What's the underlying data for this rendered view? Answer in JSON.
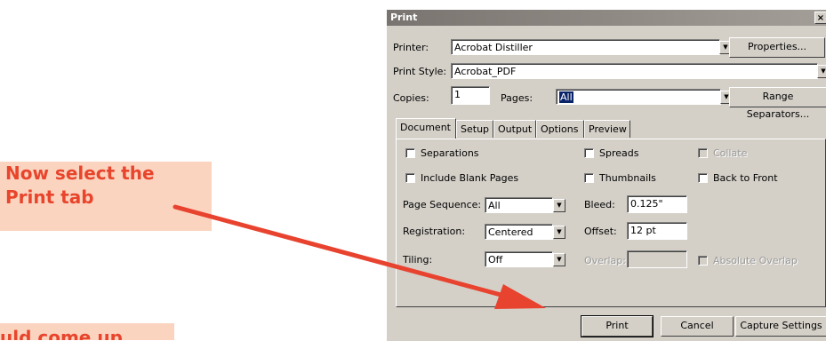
{
  "callouts": {
    "select_line1": "Now select the",
    "select_line2": "Print tab",
    "bottom": "uld come up"
  },
  "dialog": {
    "title": "Print",
    "close_glyph": "×",
    "printer_label": "Printer:",
    "printer_value": "Acrobat Distiller",
    "properties_button": "Properties...",
    "print_style_label": "Print Style:",
    "print_style_value": "Acrobat_PDF",
    "copies_label": "Copies:",
    "copies_value": "1",
    "pages_label": "Pages:",
    "pages_value": "All",
    "range_separators_button": "Range Separators...",
    "dropdown_glyph": "▼",
    "tabs": [
      "Document",
      "Setup",
      "Output",
      "Options",
      "Preview"
    ],
    "document": {
      "separations": "Separations",
      "spreads": "Spreads",
      "collate": "Collate",
      "include_blank_pages": "Include Blank Pages",
      "thumbnails": "Thumbnails",
      "back_to_front": "Back to Front",
      "page_sequence_label": "Page Sequence:",
      "page_sequence_value": "All",
      "bleed_label": "Bleed:",
      "bleed_value": "0.125\"",
      "registration_label": "Registration:",
      "registration_value": "Centered",
      "offset_label": "Offset:",
      "offset_value": "12 pt",
      "tiling_label": "Tiling:",
      "tiling_value": "Off",
      "overlap_label": "Overlap:",
      "overlap_value": "",
      "absolute_overlap": "Absolute Overlap"
    },
    "footer": {
      "print_button": "Print",
      "cancel_button": "Cancel",
      "capture_settings_button": "Capture Settings"
    }
  },
  "colors": {
    "callout_bg": "#fbd4c0",
    "callout_text": "#e8452c",
    "arrow": "#e8432f",
    "dialog_face": "#d4d0c8"
  }
}
